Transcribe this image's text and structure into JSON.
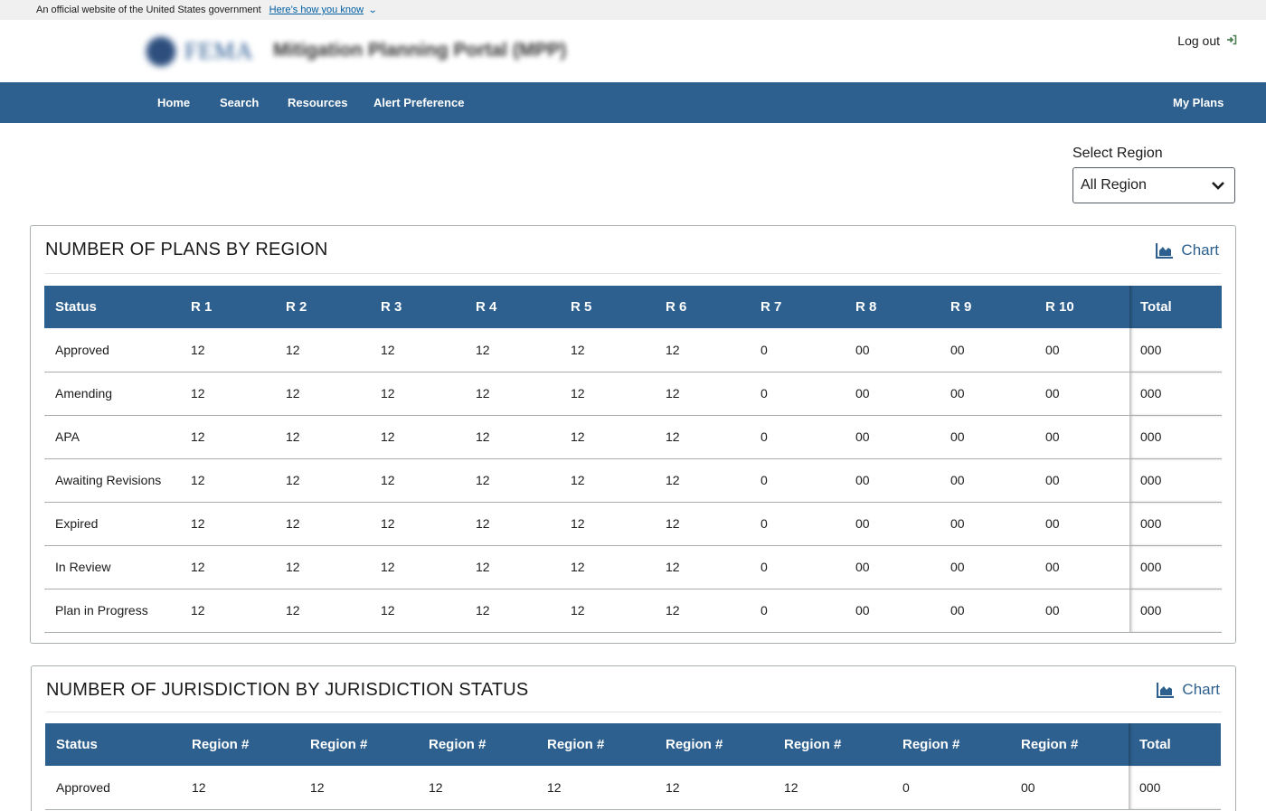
{
  "gov_banner": {
    "official_text": "An official website of the United States government",
    "how_know_link": "Here’s how you know"
  },
  "header": {
    "logo_text": "FEMA",
    "portal_title": "Mitigation Planning Portal (MPP)",
    "logout_label": "Log out"
  },
  "nav": {
    "items": [
      "Home",
      "Search",
      "Resources",
      "Alert Preference"
    ],
    "right_item": "My Plans"
  },
  "region_filter": {
    "label": "Select Region",
    "selected": "All Region"
  },
  "plans_by_region": {
    "title": "NUMBER OF PLANS BY REGION",
    "chart_button": "Chart",
    "headers": [
      "Status",
      "R 1",
      "R 2",
      "R 3",
      "R 4",
      "R 5",
      "R 6",
      "R 7",
      "R 8",
      "R 9",
      "R 10",
      "Total"
    ],
    "rows": [
      [
        "Approved",
        "12",
        "12",
        "12",
        "12",
        "12",
        "12",
        "0",
        "00",
        "00",
        "00",
        "000"
      ],
      [
        "Amending",
        "12",
        "12",
        "12",
        "12",
        "12",
        "12",
        "0",
        "00",
        "00",
        "00",
        "000"
      ],
      [
        "APA",
        "12",
        "12",
        "12",
        "12",
        "12",
        "12",
        "0",
        "00",
        "00",
        "00",
        "000"
      ],
      [
        "Awaiting Revisions",
        "12",
        "12",
        "12",
        "12",
        "12",
        "12",
        "0",
        "00",
        "00",
        "00",
        "000"
      ],
      [
        "Expired",
        "12",
        "12",
        "12",
        "12",
        "12",
        "12",
        "0",
        "00",
        "00",
        "00",
        "000"
      ],
      [
        "In Review",
        "12",
        "12",
        "12",
        "12",
        "12",
        "12",
        "0",
        "00",
        "00",
        "00",
        "000"
      ],
      [
        "Plan in Progress",
        "12",
        "12",
        "12",
        "12",
        "12",
        "12",
        "0",
        "00",
        "00",
        "00",
        "000"
      ]
    ]
  },
  "jurisdiction_by_status": {
    "title": "NUMBER OF JURISDICTION BY JURISDICTION STATUS",
    "chart_button": "Chart",
    "headers": [
      "Status",
      "Region #",
      "Region #",
      "Region #",
      "Region #",
      "Region #",
      "Region #",
      "Region #",
      "Region #",
      "Total"
    ],
    "rows": [
      [
        "Approved",
        "12",
        "12",
        "12",
        "12",
        "12",
        "12",
        "0",
        "00",
        "000"
      ]
    ]
  },
  "colors": {
    "primary_blue": "#2d608e",
    "link_blue": "#005ea2",
    "logout_icon_green": "#4d8055",
    "border_gray": "#a9aeb1"
  },
  "icons": [
    "chevron-down-icon",
    "logout-icon",
    "chart-area-icon"
  ]
}
